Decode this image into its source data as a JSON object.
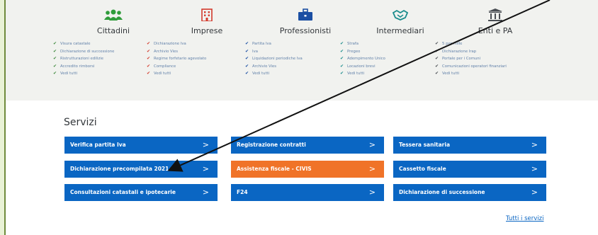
{
  "categories": [
    {
      "title": "Cittadini",
      "icon": "people-icon",
      "icon_color": "#2f9c3a",
      "items": [
        "Visura catastale",
        "Dichiarazione di successione",
        "Ristrutturazioni edilizie",
        "Accredito rimborsi",
        "Vedi tutti"
      ]
    },
    {
      "title": "Imprese",
      "icon": "building-icon",
      "icon_color": "#d33a2c",
      "items": [
        "Dichiarazione Iva",
        "Archivio Vies",
        "Regime forfetario agevolato",
        "Compliance",
        "Vedi tutti"
      ]
    },
    {
      "title": "Professionisti",
      "icon": "briefcase-icon",
      "icon_color": "#1b4fa3",
      "items": [
        "Partita Iva",
        "Iva",
        "Liquidazioni periodiche Iva",
        "Archivio Vies",
        "Vedi tutti"
      ]
    },
    {
      "title": "Intermediari",
      "icon": "handshake-icon",
      "icon_color": "#1a8c8c",
      "items": [
        "Strafa",
        "Pregeo",
        "Adempimento Unico",
        "Locazioni brevi",
        "Vedi tutti"
      ]
    },
    {
      "title": "Enti e PA",
      "icon": "public-building-icon",
      "icon_color": "#4a4e53",
      "items": [
        "5 per mille",
        "Dichiarazione Irap",
        "Portale per i Comuni",
        "Comunicazioni operatori finanziari",
        "Vedi tutti"
      ]
    }
  ],
  "services": {
    "title": "Servizi",
    "buttons": [
      {
        "label": "Verifica partita Iva",
        "color": "#0a66c3"
      },
      {
        "label": "Registrazione contratti",
        "color": "#0a66c3"
      },
      {
        "label": "Tessera sanitaria",
        "color": "#0a66c3"
      },
      {
        "label": "Dichiarazione precompilata 2021",
        "color": "#0a66c3"
      },
      {
        "label": "Assistenza fiscale - CIVIS",
        "color": "#f07328"
      },
      {
        "label": "Cassetto fiscale",
        "color": "#0a66c3"
      },
      {
        "label": "Consultazioni catastali e ipotecarie",
        "color": "#0a66c3"
      },
      {
        "label": "F24",
        "color": "#0a66c3"
      },
      {
        "label": "Dichiarazione di successione",
        "color": "#0a66c3"
      }
    ],
    "chevron": ">",
    "all_link": "Tutti i servizi"
  },
  "annotation": {
    "arrow_color": "#111111"
  }
}
